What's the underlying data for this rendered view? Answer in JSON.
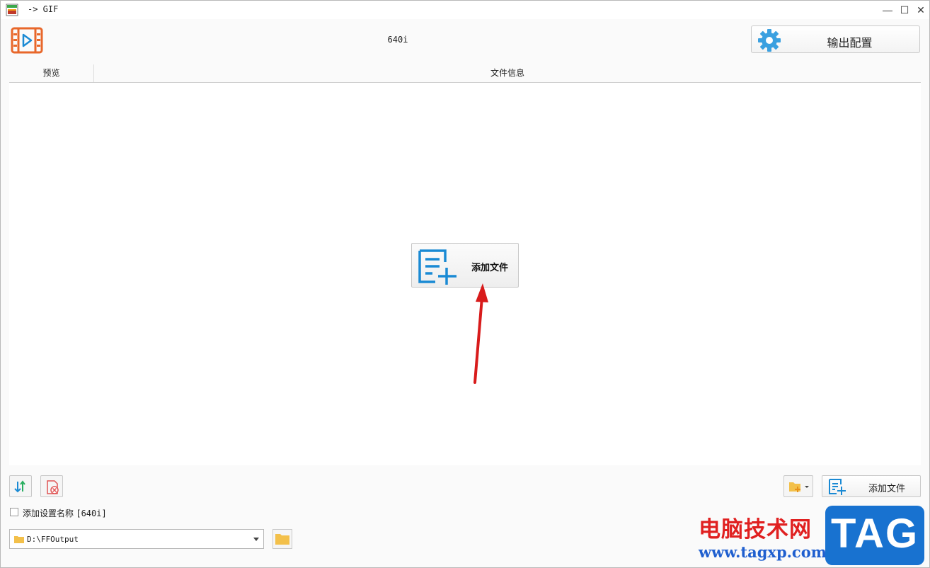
{
  "window": {
    "title": "-> GIF",
    "controls": {
      "minimize": "—",
      "maximize": "☐",
      "close": "✕"
    }
  },
  "header": {
    "preset_name": "640i",
    "output_config_label": "输出配置"
  },
  "list": {
    "columns": [
      "预览",
      "文件信息"
    ]
  },
  "center_add_label": "添加文件",
  "bottom": {
    "add_file_label": "添加文件",
    "checkbox_label": "添加设置名称",
    "checkbox_value": "[640i]",
    "checkbox_checked": false,
    "output_path": "D:\\FFOutput"
  },
  "watermark": {
    "site_name": "电脑技术网",
    "site_url": "www.tagxp.com",
    "badge": "TAG"
  },
  "colors": {
    "accent_blue": "#1a8ad4",
    "logo_orange": "#e8672a",
    "arrow_red": "#d81b1b",
    "folder_yellow": "#f3c04a"
  }
}
